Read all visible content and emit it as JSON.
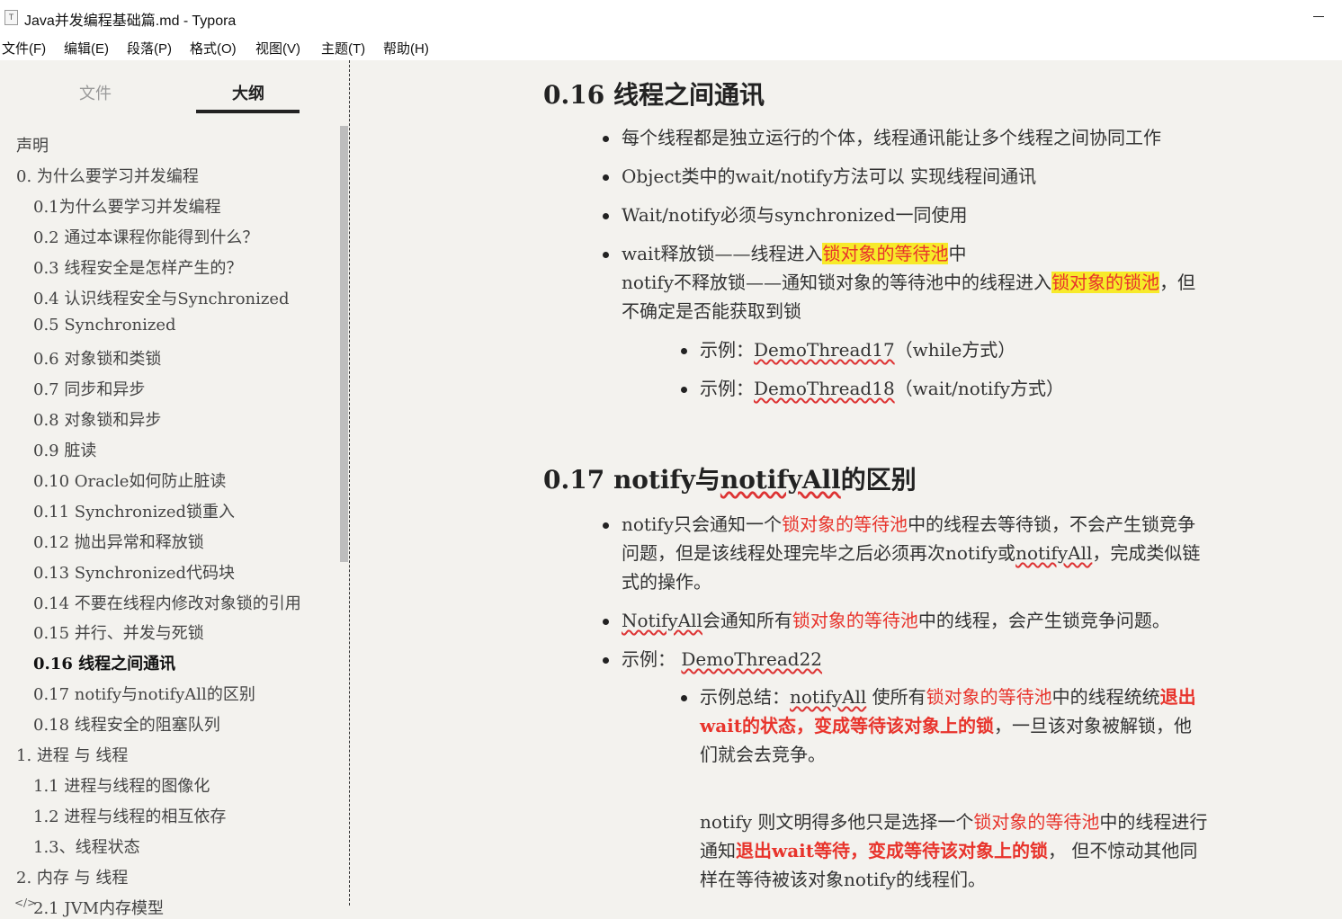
{
  "window": {
    "title": "Java并发编程基础篇.md - Typora",
    "icon": "T"
  },
  "menu": [
    "文件(F)",
    "编辑(E)",
    "段落(P)",
    "格式(O)",
    "视图(V)",
    "主题(T)",
    "帮助(H)"
  ],
  "sidebar": {
    "tabs": {
      "files": "文件",
      "outline": "大纲"
    },
    "outline": [
      {
        "label": "声明",
        "level": 0
      },
      {
        "label": "0. 为什么要学习并发编程",
        "level": 0
      },
      {
        "label": "0.1为什么要学习并发编程",
        "level": 1
      },
      {
        "label": "0.2 通过本课程你能得到什么？",
        "level": 1
      },
      {
        "label": "0.3 线程安全是怎样产生的？",
        "level": 1
      },
      {
        "label": "0.4 认识线程安全与Synchronized",
        "level": 1
      },
      {
        "label": "0.5 Synchronized",
        "level": 1
      },
      {
        "label": "0.6 对象锁和类锁",
        "level": 1
      },
      {
        "label": "0.7 同步和异步",
        "level": 1
      },
      {
        "label": "0.8 对象锁和异步",
        "level": 1
      },
      {
        "label": "0.9 脏读",
        "level": 1
      },
      {
        "label": "0.10 Oracle如何防止脏读",
        "level": 1
      },
      {
        "label": "0.11 Synchronized锁重入",
        "level": 1
      },
      {
        "label": "0.12 抛出异常和释放锁",
        "level": 1
      },
      {
        "label": "0.13 Synchronized代码块",
        "level": 1
      },
      {
        "label": "0.14 不要在线程内修改对象锁的引用",
        "level": 1
      },
      {
        "label": "0.15 并行、并发与死锁",
        "level": 1
      },
      {
        "label": "0.16 线程之间通讯",
        "level": 1,
        "active": true
      },
      {
        "label": "0.17 notify与notifyAll的区别",
        "level": 1
      },
      {
        "label": "0.18 线程安全的阻塞队列",
        "level": 1
      },
      {
        "label": "1. 进程 与 线程",
        "level": 0
      },
      {
        "label": "1.1 进程与线程的图像化",
        "level": 1
      },
      {
        "label": "1.2 进程与线程的相互依存",
        "level": 1
      },
      {
        "label": "1.3、线程状态",
        "level": 1
      },
      {
        "label": "2. 内存 与 线程",
        "level": 0
      },
      {
        "label": "2.1 JVM内存模型",
        "level": 1
      }
    ]
  },
  "doc": {
    "s16": {
      "heading": "0.16 线程之间通讯",
      "b1": "每个线程都是独立运行的个体，线程通讯能让多个线程之间协同工作",
      "b2": "Object类中的wait/notify方法可以 实现线程间通讯",
      "b3": "Wait/notify必须与synchronized一同使用",
      "b4_1a": "wait释放锁——线程进入",
      "b4_1hl": "锁对象的等待池",
      "b4_1b": "中",
      "b4_2a": "notify不释放锁——通知锁对象的等待池中的线程进入",
      "b4_2hl": "锁对象的锁池",
      "b4_2b": "，但",
      "b4_3": "不确定是否能获取到锁",
      "sub1_pre": "示例：",
      "sub1_link": "DemoThread17",
      "sub1_post": "（while方式）",
      "sub2_pre": "示例：",
      "sub2_link": "DemoThread18",
      "sub2_post": "（wait/notify方式）"
    },
    "s17": {
      "heading_a": "0.17 notify与",
      "heading_b": "notifyAll",
      "heading_c": "的区别",
      "b1_1a": "notify只会通知一个",
      "b1_1r": "锁对象的等待池",
      "b1_1b": "中的线程去等待锁，不会产生锁竞争",
      "b1_2a": "问题，但是该线程处理完毕之后必须再次notify或",
      "b1_2w": "notifyAll",
      "b1_2b": "，完成类似链",
      "b1_3": "式的操作。",
      "b2_w": "NotifyAll",
      "b2_a": "会通知所有",
      "b2_r": "锁对象的等待池",
      "b2_b": "中的线程，会产生锁竞争问题。",
      "b3_pre": "示例：",
      "b3_link": "DemoThread22",
      "sub_1a": "示例总结：",
      "sub_1w": "notifyAll",
      "sub_1b": " 使所有",
      "sub_1r": "锁对象的等待池",
      "sub_1c": "中的线程统统",
      "sub_1rb": "退出",
      "sub_2rb": "wait的状态，变成等待该对象上的锁",
      "sub_2b": "，一旦该对象被解锁，他",
      "sub_3": "们就会去竞争。",
      "p_1a": "notify 则文明得多他只是选择一个",
      "p_1r": "锁对象的等待池",
      "p_1b": "中的线程进行",
      "p_2a": "通知",
      "p_2rb": "退出wait等待，变成等待该对象上的锁",
      "p_2b": "， 但不惊动其他同",
      "p_3": "样在等待被该对象notify的线程们。"
    }
  },
  "footer_mark": "</>"
}
